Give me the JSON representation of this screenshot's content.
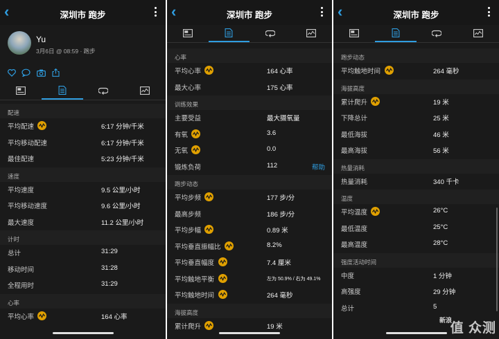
{
  "header": {
    "title": "深圳市 跑步"
  },
  "profile": {
    "name": "Yu",
    "date": "3月6日 @ 08:59 · 跑步"
  },
  "tabs": [
    "overview-icon",
    "stats-icon",
    "laps-icon",
    "chart-icon"
  ],
  "panel1": {
    "rows": [
      {
        "section": "配速"
      },
      {
        "label": "平均配速",
        "icon": true,
        "value": "6:17 分钟/千米"
      },
      {
        "label": "平均移动配速",
        "value": "6:17 分钟/千米"
      },
      {
        "label": "最佳配速",
        "value": "5:23 分钟/千米"
      },
      {
        "section": "速度"
      },
      {
        "label": "平均速度",
        "value": "9.5 公里/小时"
      },
      {
        "label": "平均移动速度",
        "value": "9.6 公里/小时"
      },
      {
        "label": "最大速度",
        "value": "11.2 公里/小时"
      },
      {
        "section": "计时"
      },
      {
        "label": "总计",
        "value": "31:29"
      },
      {
        "label": "移动时间",
        "value": "31:28"
      },
      {
        "label": "全程用时",
        "value": "31:29"
      },
      {
        "section": "心率"
      },
      {
        "label": "平均心率",
        "icon": true,
        "value": "164 心率"
      }
    ]
  },
  "panel2": {
    "rows": [
      {
        "section": "心率"
      },
      {
        "label": "平均心率",
        "icon": true,
        "value": "164 心率"
      },
      {
        "label": "最大心率",
        "value": "175 心率"
      },
      {
        "section": "训练效果"
      },
      {
        "label": "主要受益",
        "value": "最大摄氧量"
      },
      {
        "label": "有氧",
        "icon": true,
        "value": "3.6"
      },
      {
        "label": "无氧",
        "icon": true,
        "value": "0.0"
      },
      {
        "label": "锻炼负荷",
        "value": "112",
        "action": "帮助"
      },
      {
        "section": "跑步动态"
      },
      {
        "label": "平均步频",
        "icon": true,
        "value": "177 步/分"
      },
      {
        "label": "最高步频",
        "value": "186 步/分"
      },
      {
        "label": "平均步幅",
        "icon": true,
        "value": "0.89 米"
      },
      {
        "label": "平均垂直振幅比",
        "icon": true,
        "value": "8.2%"
      },
      {
        "label": "平均垂直幅度",
        "icon": true,
        "value": "7.4 厘米"
      },
      {
        "label": "平均触地平衡",
        "icon": true,
        "value": "左为 50.9% / 右为 49.1%",
        "small": true
      },
      {
        "label": "平均触地时间",
        "icon": true,
        "value": "264 毫秒"
      },
      {
        "section": "海拔高度"
      },
      {
        "label": "累计爬升",
        "icon": true,
        "value": "19 米"
      }
    ]
  },
  "panel3": {
    "rows": [
      {
        "section": "跑步动态"
      },
      {
        "label": "平均触地时间",
        "icon": true,
        "value": "264 毫秒"
      },
      {
        "section": "海拔高度"
      },
      {
        "label": "累计爬升",
        "icon": true,
        "value": "19 米"
      },
      {
        "label": "下降总计",
        "value": "25 米"
      },
      {
        "label": "最低海拔",
        "value": "46 米"
      },
      {
        "label": "最高海拔",
        "value": "56 米"
      },
      {
        "section": "热量消耗"
      },
      {
        "label": "热量消耗",
        "value": "340 千卡"
      },
      {
        "section": "温度"
      },
      {
        "label": "平均温度",
        "icon": true,
        "value": "26°C"
      },
      {
        "label": "最低温度",
        "value": "25°C"
      },
      {
        "label": "最高温度",
        "value": "28°C"
      },
      {
        "section": "强度活动时间"
      },
      {
        "label": "中度",
        "value": "1 分钟"
      },
      {
        "label": "高强度",
        "value": "29 分钟"
      },
      {
        "label": "总计",
        "value": "5"
      }
    ]
  },
  "watermark": {
    "badge": "新浪",
    "text": "值 众测"
  },
  "colors": {
    "accent": "#2f9de0",
    "gauge": "#e0a000",
    "background": "#1a1a1a"
  }
}
